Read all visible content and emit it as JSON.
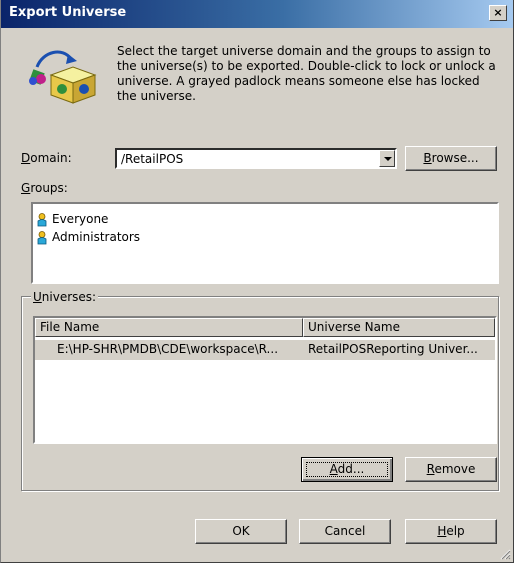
{
  "window": {
    "title": "Export Universe",
    "close_glyph": "×"
  },
  "description": "Select the target universe domain and the groups to assign to the universe(s) to be exported. Double-click to lock or unlock a universe. A grayed padlock means someone else has locked the universe.",
  "domain": {
    "label_mnemonic": "D",
    "label_rest": "omain:",
    "value": "/RetailPOS"
  },
  "browse_button": {
    "mnemonic": "B",
    "rest": "rowse..."
  },
  "groups": {
    "label_mnemonic": "G",
    "label_rest": "roups:",
    "items": [
      {
        "label": "Everyone",
        "icon": "user-group-icon"
      },
      {
        "label": "Administrators",
        "icon": "user-group-icon"
      }
    ]
  },
  "universes": {
    "label_mnemonic": "U",
    "label_rest": "niverses:",
    "columns": [
      "File Name",
      "Universe Name"
    ],
    "rows": [
      {
        "file_name": "E:\\HP-SHR\\PMDB\\CDE\\workspace\\R...",
        "universe_name": "RetailPOSReporting Univer..."
      }
    ]
  },
  "add_button": {
    "mnemonic": "A",
    "rest": "dd..."
  },
  "remove_button": {
    "mnemonic": "R",
    "rest": "emove"
  },
  "ok_button": "OK",
  "cancel_button": "Cancel",
  "help_button": {
    "mnemonic": "H",
    "rest": "elp"
  },
  "colors": {
    "dialog_bg": "#d4d0c8",
    "title_start": "#0a246a",
    "title_end": "#a6caf0"
  }
}
